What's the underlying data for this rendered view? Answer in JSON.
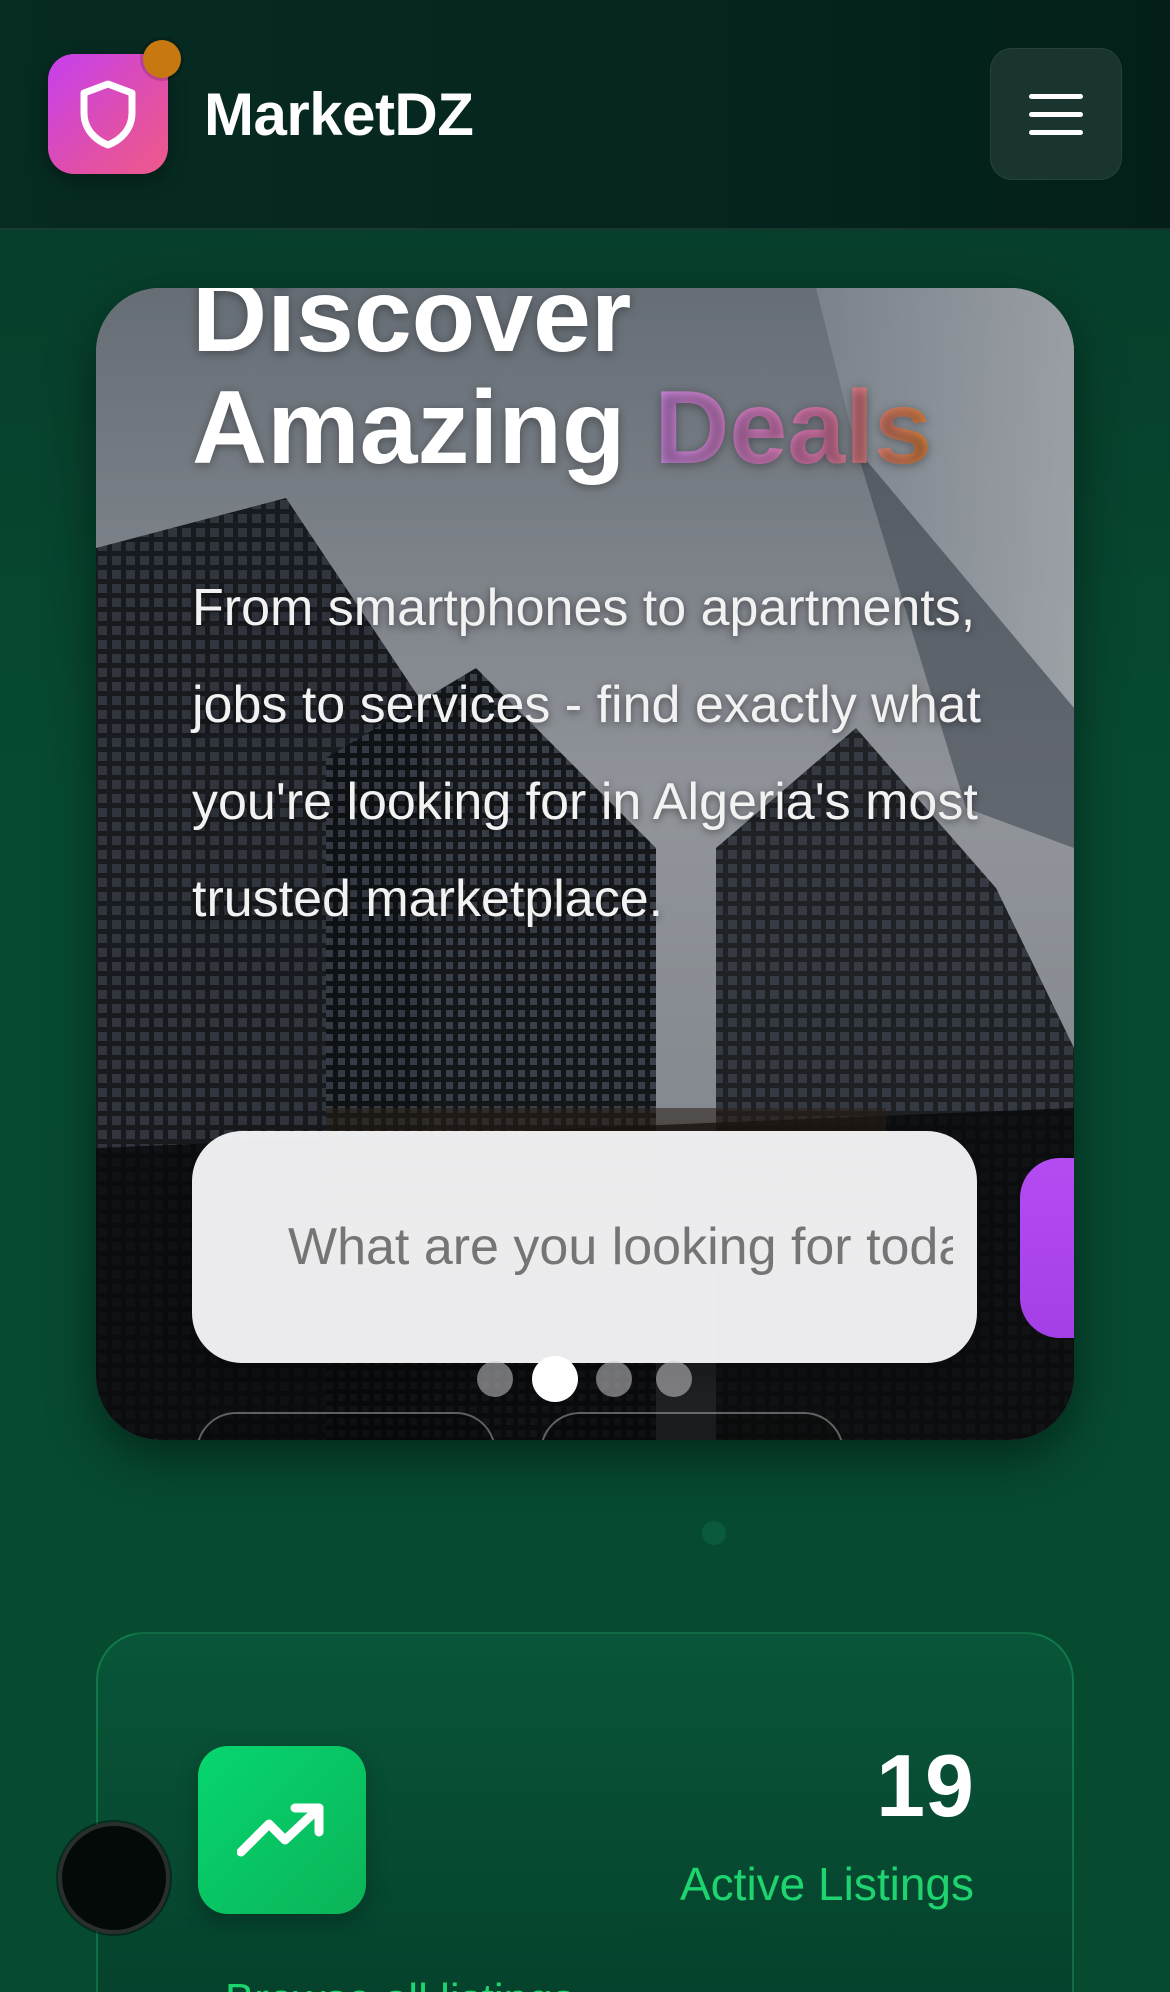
{
  "header": {
    "brand": "MarketDZ",
    "logo_icon": "shield-icon",
    "menu_icon": "hamburger-menu-icon"
  },
  "hero": {
    "title_line1": "Discover",
    "title_line2_plain": "Amazing",
    "title_line2_accent": "Deals",
    "description": "From smartphones to apartments, jobs to services - find exactly what you're looking for in Algeria's most trusted marketplace.",
    "search_placeholder": "What are you looking for today?",
    "carousel_slides": 4,
    "carousel_active_index": 1
  },
  "stats": {
    "count": "19",
    "label": "Active Listings",
    "link_text": "Browse all listings",
    "icon": "trending-up-icon"
  },
  "colors": {
    "brand_gradient_start": "#c63ff0",
    "brand_gradient_end": "#ef5a8a",
    "accent_green": "#1ed46f",
    "background": "#07452f"
  }
}
